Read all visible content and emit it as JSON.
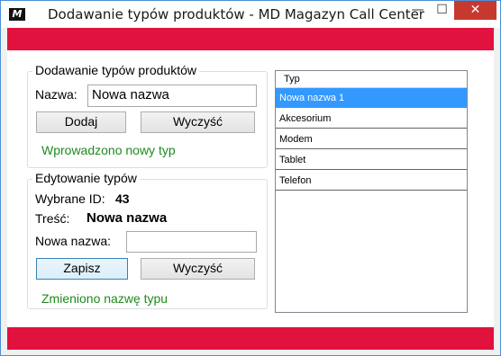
{
  "window": {
    "title": "Dodawanie typów produktów - MD Magazyn Call Center",
    "app_icon_text": "M",
    "minimize_glyph": "—",
    "maximize_glyph": "☐",
    "close_glyph": "✕"
  },
  "colors": {
    "band": "#e2123e",
    "status_text": "#1e8a1e",
    "selection": "#3399ff"
  },
  "add_group": {
    "legend": "Dodawanie typów produktów",
    "name_label": "Nazwa:",
    "name_value": "Nowa nazwa",
    "add_button": "Dodaj",
    "clear_button": "Wyczyść",
    "status": "Wprowadzono nowy typ"
  },
  "edit_group": {
    "legend": "Edytowanie typów",
    "selected_id_label": "Wybrane ID:",
    "selected_id_value": "43",
    "content_label": "Treść:",
    "content_value": "Nowa nazwa",
    "new_name_label": "Nowa nazwa:",
    "new_name_value": "",
    "save_button": "Zapisz",
    "clear_button": "Wyczyść",
    "status": "Zmieniono nazwę typu"
  },
  "types_list": {
    "column_header": "Typ",
    "rows": [
      "Nowa nazwa 1",
      "Akcesorium",
      "Modem",
      "Tablet",
      "Telefon"
    ],
    "selected_index": 0
  }
}
